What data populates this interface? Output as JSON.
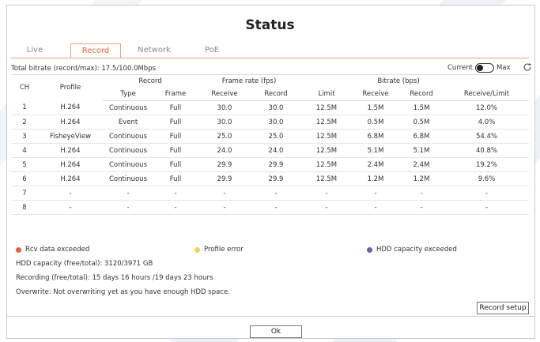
{
  "title": "Status",
  "tabs": [
    {
      "label": "Live",
      "active": false
    },
    {
      "label": "Record",
      "active": true
    },
    {
      "label": "Network",
      "active": false
    },
    {
      "label": "PoE",
      "active": false
    }
  ],
  "total_bitrate": "Total bitrate (record/max): 17.5/100.0Mbps",
  "toggle": {
    "left_label": "Current",
    "right_label": "Max"
  },
  "table": {
    "headers": {
      "ch": "CH",
      "profile": "Profile",
      "record": "Record",
      "frame_rate": "Frame rate (fps)",
      "bitrate": "Bitrate (bps)",
      "type": "Type",
      "frame": "Frame",
      "fr_receive": "Receive",
      "fr_record": "Record",
      "limit": "Limit",
      "br_receive": "Receive",
      "br_record": "Record",
      "receive_limit": "Receive/Limit"
    },
    "rows": [
      [
        "1",
        "H.264",
        "Continuous",
        "Full",
        "30.0",
        "30.0",
        "12.5M",
        "1.5M",
        "1.5M",
        "12.0%"
      ],
      [
        "2",
        "H.264",
        "Event",
        "Full",
        "30.0",
        "30.0",
        "12.5M",
        "0.5M",
        "0.5M",
        "4.0%"
      ],
      [
        "3",
        "FisheyeView",
        "Continuous",
        "Full",
        "25.0",
        "25.0",
        "12.5M",
        "6.8M",
        "6.8M",
        "54.4%"
      ],
      [
        "4",
        "H.264",
        "Continuous",
        "Full",
        "24.0",
        "24.0",
        "12.5M",
        "5.1M",
        "5.1M",
        "40.8%"
      ],
      [
        "5",
        "H.264",
        "Continuous",
        "Full",
        "29.9",
        "29.9",
        "12.5M",
        "2.4M",
        "2.4M",
        "19.2%"
      ],
      [
        "6",
        "H.264",
        "Continuous",
        "Full",
        "29.9",
        "29.9",
        "12.5M",
        "1.2M",
        "1.2M",
        "9.6%"
      ],
      [
        "7",
        "-",
        "-",
        "-",
        "-",
        "-",
        "-",
        "-",
        "-",
        "-"
      ],
      [
        "8",
        "-",
        "-",
        "-",
        "-",
        "-",
        "-",
        "-",
        "-",
        "-"
      ]
    ]
  },
  "legend": [
    {
      "label": "Rcv data exceeded",
      "color": "#e8603a"
    },
    {
      "label": "Profile error",
      "color": "#f2d74a"
    },
    {
      "label": "HDD capacity exceeded",
      "color": "#7a5ab8"
    }
  ],
  "info": {
    "hdd": "HDD capacity (free/total): 3120/3971 GB",
    "recording": "Recording (free/total): 15 days 16 hours /19 days 23 hours",
    "overwrite": "Overwrite: Not overwriting yet as you have enough HDD space."
  },
  "buttons": {
    "record_setup": "Record setup",
    "ok": "Ok"
  },
  "colors": {
    "accent": "#e8603a",
    "watermark": "#e6ecf6"
  }
}
